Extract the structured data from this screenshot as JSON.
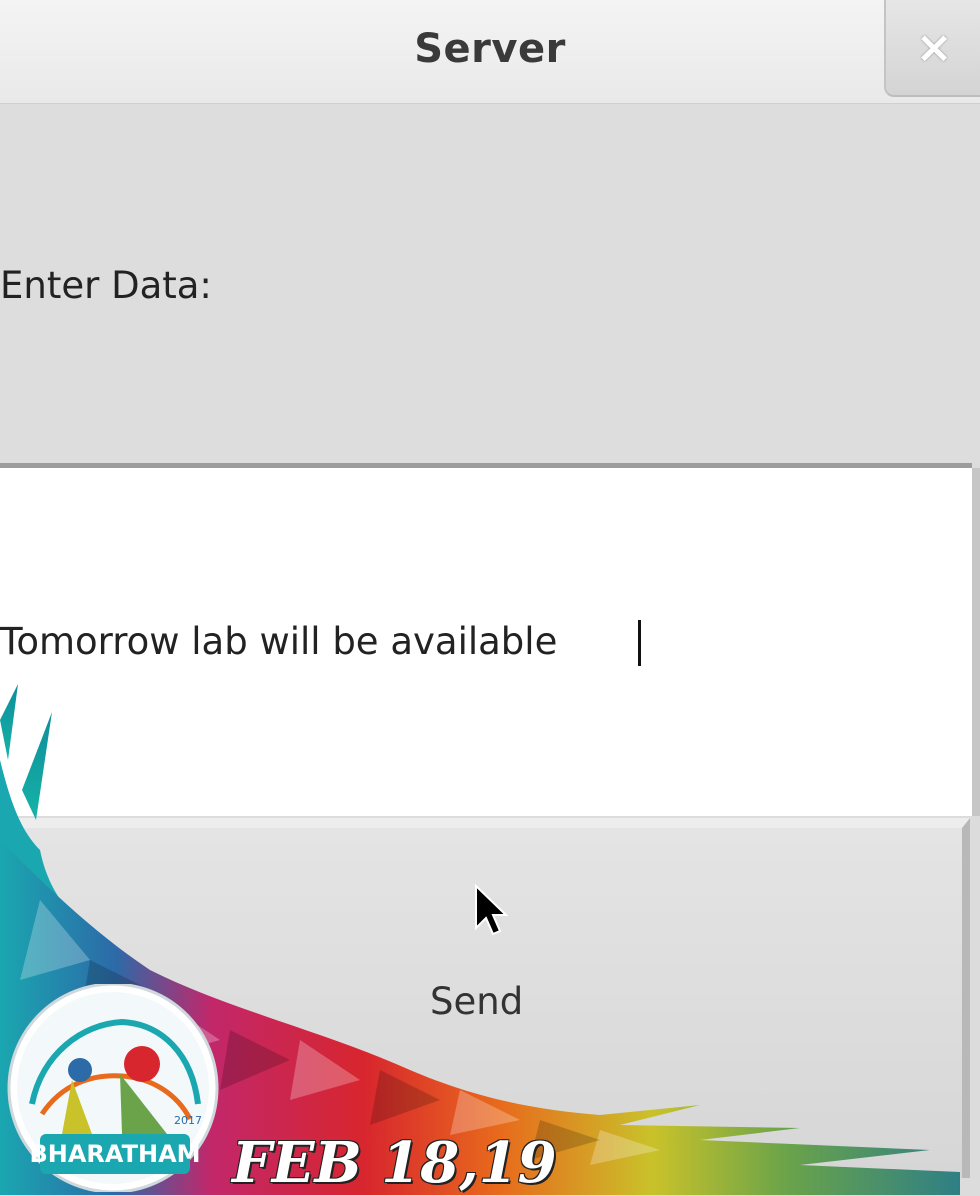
{
  "window": {
    "title": "Server",
    "close_glyph": "×"
  },
  "form": {
    "label": "Enter Data:",
    "input_value": "Tomorrow lab will be available ",
    "send_label": "Send"
  },
  "banner": {
    "logo_text": "BHARATHAM",
    "logo_year": "2017",
    "date_text": "FEB 18,19"
  },
  "icons": {
    "close": "close-icon",
    "cursor": "mouse-pointer-icon",
    "logo": "festival-logo-icon"
  },
  "colors": {
    "window_bg": "#dcdcdc",
    "field_bg": "#ffffff",
    "accent_teal": "#1aa7b0",
    "accent_red": "#d8262e",
    "accent_yellow": "#e7d22a"
  }
}
